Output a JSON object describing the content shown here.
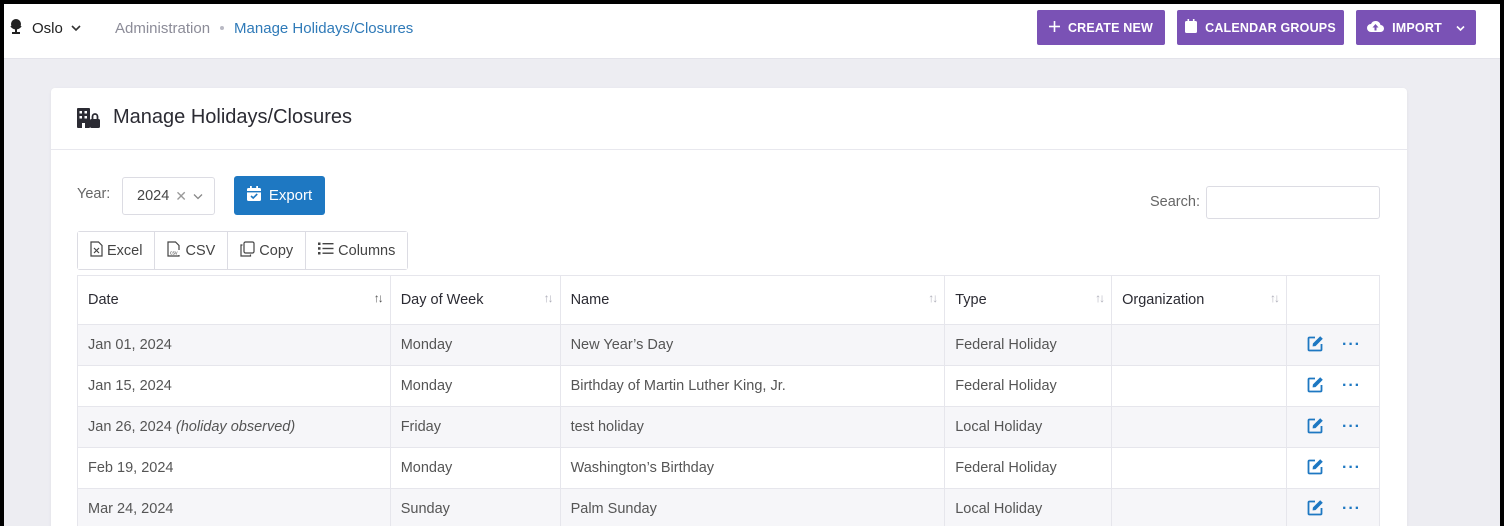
{
  "topbar": {
    "org_name": "Oslo",
    "breadcrumb": [
      "Administration",
      "Manage Holidays/Closures"
    ],
    "buttons": {
      "create_new": "CREATE NEW",
      "calendar_groups": "CALENDAR GROUPS",
      "import": "IMPORT"
    }
  },
  "card": {
    "title": "Manage Holidays/Closures",
    "year_label": "Year:",
    "year_value": "2024",
    "export_label": "Export",
    "search_label": "Search:",
    "toolbar": [
      "Excel",
      "CSV",
      "Copy",
      "Columns"
    ]
  },
  "table": {
    "headers": [
      "Date",
      "Day of Week",
      "Name",
      "Type",
      "Organization"
    ],
    "rows": [
      {
        "date": "Jan 01, 2024",
        "note": "",
        "day": "Monday",
        "name": "New Year’s Day",
        "type": "Federal Holiday",
        "org": ""
      },
      {
        "date": "Jan 15, 2024",
        "note": "",
        "day": "Monday",
        "name": "Birthday of Martin Luther King, Jr.",
        "type": "Federal Holiday",
        "org": ""
      },
      {
        "date": "Jan 26, 2024",
        "note": "(holiday observed)",
        "day": "Friday",
        "name": "test holiday",
        "type": "Local Holiday",
        "org": ""
      },
      {
        "date": "Feb 19, 2024",
        "note": "",
        "day": "Monday",
        "name": "Washington’s Birthday",
        "type": "Federal Holiday",
        "org": ""
      },
      {
        "date": "Mar 24, 2024",
        "note": "",
        "day": "Sunday",
        "name": "Palm Sunday",
        "type": "Local Holiday",
        "org": ""
      }
    ]
  },
  "colors": {
    "accent_purple": "#7a52b5",
    "accent_blue": "#1e78c2",
    "link_blue": "#2f7ab8"
  },
  "icons": {
    "org": "globe-stand-icon",
    "title": "building-lock-icon",
    "edit": "edit-icon",
    "more": "more-horizontal-icon"
  }
}
